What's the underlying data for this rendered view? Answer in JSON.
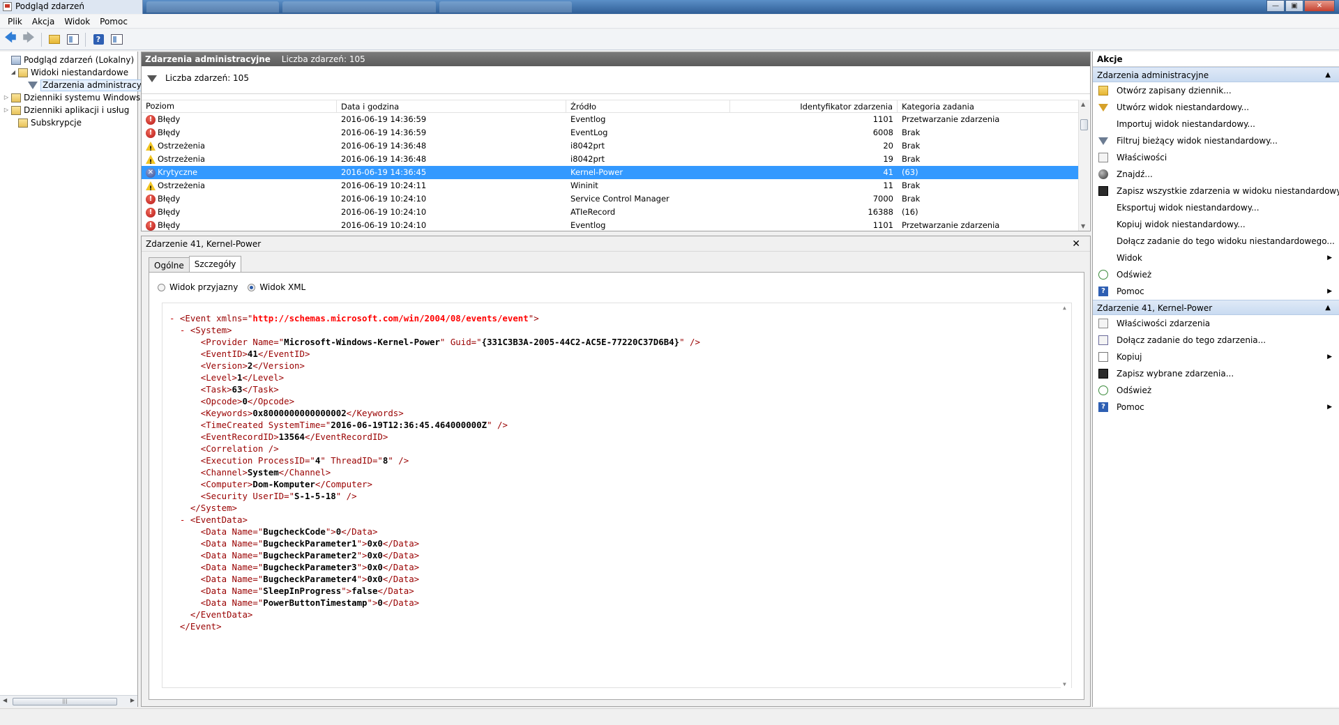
{
  "window": {
    "title": "Podgląd zdarzeń"
  },
  "menu": [
    "Plik",
    "Akcja",
    "Widok",
    "Pomoc"
  ],
  "toolbar": {
    "icons": [
      "back-arrow-icon",
      "forward-arrow-icon",
      "up-folder-icon",
      "show-hide-tree-icon",
      "help-icon",
      "show-hide-action-pane-icon"
    ]
  },
  "tree": {
    "root": "Podgląd zdarzeń (Lokalny)",
    "custom_views": "Widoki niestandardowe",
    "admin_events": "Zdarzenia administracyjne",
    "windows_logs": "Dzienniki systemu Windows",
    "app_logs": "Dzienniki aplikacji i usług",
    "subscriptions": "Subskrypcje"
  },
  "list_pane": {
    "title": "Zdarzenia administracyjne",
    "count_text": "Liczba zdarzeń: 105",
    "filter_text": "Liczba zdarzeń: 105",
    "columns": {
      "level": "Poziom",
      "date": "Data i godzina",
      "source": "Źródło",
      "event_id": "Identyfikator zdarzenia",
      "category": "Kategoria zadania"
    },
    "rows": [
      {
        "level": "Błędy",
        "type": "error",
        "date": "2016-06-19 14:36:59",
        "source": "Eventlog",
        "event_id": "1101",
        "category": "Przetwarzanie zdarzenia"
      },
      {
        "level": "Błędy",
        "type": "error",
        "date": "2016-06-19 14:36:59",
        "source": "EventLog",
        "event_id": "6008",
        "category": "Brak"
      },
      {
        "level": "Ostrzeżenia",
        "type": "warning",
        "date": "2016-06-19 14:36:48",
        "source": "i8042prt",
        "event_id": "20",
        "category": "Brak"
      },
      {
        "level": "Ostrzeżenia",
        "type": "warning",
        "date": "2016-06-19 14:36:48",
        "source": "i8042prt",
        "event_id": "19",
        "category": "Brak"
      },
      {
        "level": "Krytyczne",
        "type": "critical",
        "date": "2016-06-19 14:36:45",
        "source": "Kernel-Power",
        "event_id": "41",
        "category": "(63)",
        "selected": true
      },
      {
        "level": "Ostrzeżenia",
        "type": "warning",
        "date": "2016-06-19 10:24:11",
        "source": "Wininit",
        "event_id": "11",
        "category": "Brak"
      },
      {
        "level": "Błędy",
        "type": "error",
        "date": "2016-06-19 10:24:10",
        "source": "Service Control Manager",
        "event_id": "7000",
        "category": "Brak"
      },
      {
        "level": "Błędy",
        "type": "error",
        "date": "2016-06-19 10:24:10",
        "source": "ATIeRecord",
        "event_id": "16388",
        "category": "(16)"
      },
      {
        "level": "Błędy",
        "type": "error",
        "date": "2016-06-19 10:24:10",
        "source": "Eventlog",
        "event_id": "1101",
        "category": "Przetwarzanie zdarzenia"
      }
    ]
  },
  "detail": {
    "title": "Zdarzenie 41, Kernel-Power",
    "tabs": [
      "Ogólne",
      "Szczegóły"
    ],
    "active_tab": "Szczegóły",
    "view_friendly": "Widok przyjazny",
    "view_xml": "Widok XML",
    "selected_view": "Widok XML",
    "xml": {
      "namespace": "http://schemas.microsoft.com/win/2004/08/events/event",
      "provider_name": "Microsoft-Windows-Kernel-Power",
      "provider_guid": "{331C3B3A-2005-44C2-AC5E-77220C37D6B4}",
      "event_id": "41",
      "version": "2",
      "level": "1",
      "task": "63",
      "opcode": "0",
      "keywords": "0x8000000000000002",
      "time_created": "2016-06-19T12:36:45.464000000Z",
      "record_id": "13564",
      "process_id": "4",
      "thread_id": "8",
      "channel": "System",
      "computer": "Dom-Komputer",
      "user_id": "S-1-5-18",
      "data": [
        {
          "name": "BugcheckCode",
          "value": "0"
        },
        {
          "name": "BugcheckParameter1",
          "value": "0x0"
        },
        {
          "name": "BugcheckParameter2",
          "value": "0x0"
        },
        {
          "name": "BugcheckParameter3",
          "value": "0x0"
        },
        {
          "name": "BugcheckParameter4",
          "value": "0x0"
        },
        {
          "name": "SleepInProgress",
          "value": "false"
        },
        {
          "name": "PowerButtonTimestamp",
          "value": "0"
        }
      ]
    }
  },
  "actions": {
    "title": "Akcje",
    "section1": {
      "title": "Zdarzenia administracyjne",
      "items": [
        {
          "label": "Otwórz zapisany dziennik...",
          "icon": "folder"
        },
        {
          "label": "Utwórz widok niestandardowy...",
          "icon": "filtery"
        },
        {
          "label": "Importuj widok niestandardowy...",
          "icon": "none"
        },
        {
          "label": "Filtruj bieżący widok niestandardowy...",
          "icon": "filter"
        },
        {
          "label": "Właściwości",
          "icon": "props"
        },
        {
          "label": "Znajdź...",
          "icon": "find"
        },
        {
          "label": "Zapisz wszystkie zdarzenia w widoku niestandardowym...",
          "icon": "save"
        },
        {
          "label": "Eksportuj widok niestandardowy...",
          "icon": "none"
        },
        {
          "label": "Kopiuj widok niestandardowy...",
          "icon": "none"
        },
        {
          "label": "Dołącz zadanie do tego widoku niestandardowego...",
          "icon": "none"
        },
        {
          "label": "Widok",
          "icon": "none",
          "submenu": true
        },
        {
          "label": "Odśwież",
          "icon": "refresh"
        },
        {
          "label": "Pomoc",
          "icon": "help",
          "submenu": true
        }
      ]
    },
    "section2": {
      "title": "Zdarzenie 41, Kernel-Power",
      "items": [
        {
          "label": "Właściwości zdarzenia",
          "icon": "props"
        },
        {
          "label": "Dołącz zadanie do tego zdarzenia...",
          "icon": "task"
        },
        {
          "label": "Kopiuj",
          "icon": "copy",
          "submenu": true
        },
        {
          "label": "Zapisz wybrane zdarzenia...",
          "icon": "save"
        },
        {
          "label": "Odśwież",
          "icon": "refresh"
        },
        {
          "label": "Pomoc",
          "icon": "help",
          "submenu": true
        }
      ]
    }
  }
}
